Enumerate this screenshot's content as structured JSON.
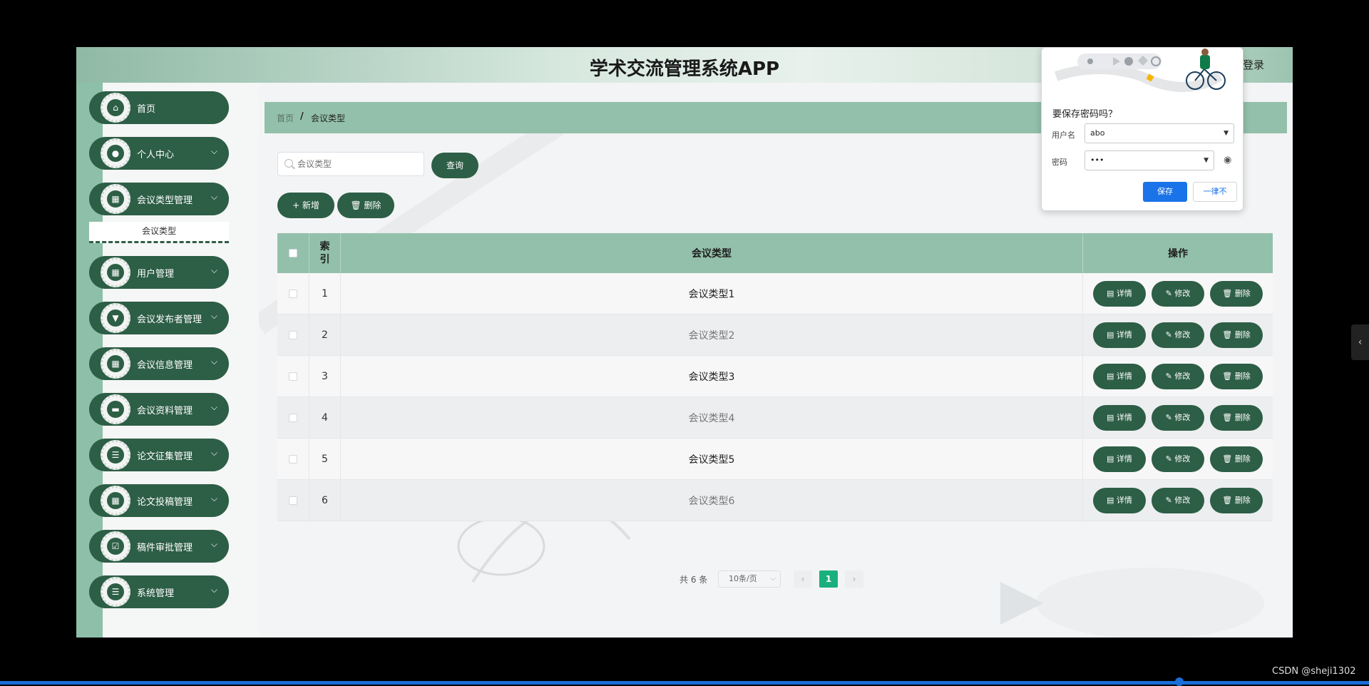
{
  "header": {
    "title": "学术交流管理系统APP",
    "login": "登录"
  },
  "sidebar": {
    "items": [
      {
        "label": "首页",
        "icon": "home-icon",
        "glyph": "⌂",
        "chevron": ""
      },
      {
        "label": "个人中心",
        "icon": "user-icon",
        "glyph": "●",
        "chevron": "⌵"
      },
      {
        "label": "会议类型管理",
        "icon": "grid-icon",
        "glyph": "▦",
        "chevron": "⌵"
      },
      {
        "label": "用户管理",
        "icon": "grid-icon",
        "glyph": "▦",
        "chevron": "⌵"
      },
      {
        "label": "会议发布者管理",
        "icon": "filter-icon",
        "glyph": "▼",
        "chevron": "⌵"
      },
      {
        "label": "会议信息管理",
        "icon": "grid-icon",
        "glyph": "▦",
        "chevron": "⌵"
      },
      {
        "label": "会议资料管理",
        "icon": "chat-icon",
        "glyph": "▬",
        "chevron": "⌵"
      },
      {
        "label": "论文征集管理",
        "icon": "list-icon",
        "glyph": "☰",
        "chevron": "⌵"
      },
      {
        "label": "论文投稿管理",
        "icon": "grid-icon",
        "glyph": "▦",
        "chevron": "⌵"
      },
      {
        "label": "稿件审批管理",
        "icon": "checkbox-icon",
        "glyph": "☑",
        "chevron": "⌵"
      },
      {
        "label": "系统管理",
        "icon": "list-icon",
        "glyph": "☰",
        "chevron": "⌵"
      }
    ],
    "submenu": "会议类型"
  },
  "breadcrumb": {
    "home": "首页",
    "sep": "/",
    "current": "会议类型"
  },
  "search": {
    "placeholder": "会议类型",
    "query_label": "查询"
  },
  "toolbar": {
    "add_label": "+ 新增",
    "delete_label": "🗑 删除"
  },
  "table": {
    "headers": {
      "index": "索\n引",
      "type": "会议类型",
      "ops": "操作"
    },
    "rows": [
      {
        "index": "1",
        "type": "会议类型1"
      },
      {
        "index": "2",
        "type": "会议类型2"
      },
      {
        "index": "3",
        "type": "会议类型3"
      },
      {
        "index": "4",
        "type": "会议类型4"
      },
      {
        "index": "5",
        "type": "会议类型5"
      },
      {
        "index": "6",
        "type": "会议类型6"
      }
    ],
    "actions": {
      "detail": "▤ 详情",
      "edit": "✎ 修改",
      "delete": "🗑 删除"
    }
  },
  "pagination": {
    "total": "共 6 条",
    "page_size": "10条/页",
    "current": "1",
    "prev": "‹",
    "next": "›"
  },
  "password_popup": {
    "question": "要保存密码吗？",
    "username_label": "用户名",
    "username_value": "abo",
    "password_label": "密码",
    "password_value": "•••",
    "save": "保存",
    "never": "一律不"
  },
  "watermark": "CSDN @sheji1302",
  "colors": {
    "accent": "#2d5e46",
    "header_green": "#93c0ab",
    "page_active": "#19b07d",
    "chrome_blue": "#1a73e8"
  }
}
